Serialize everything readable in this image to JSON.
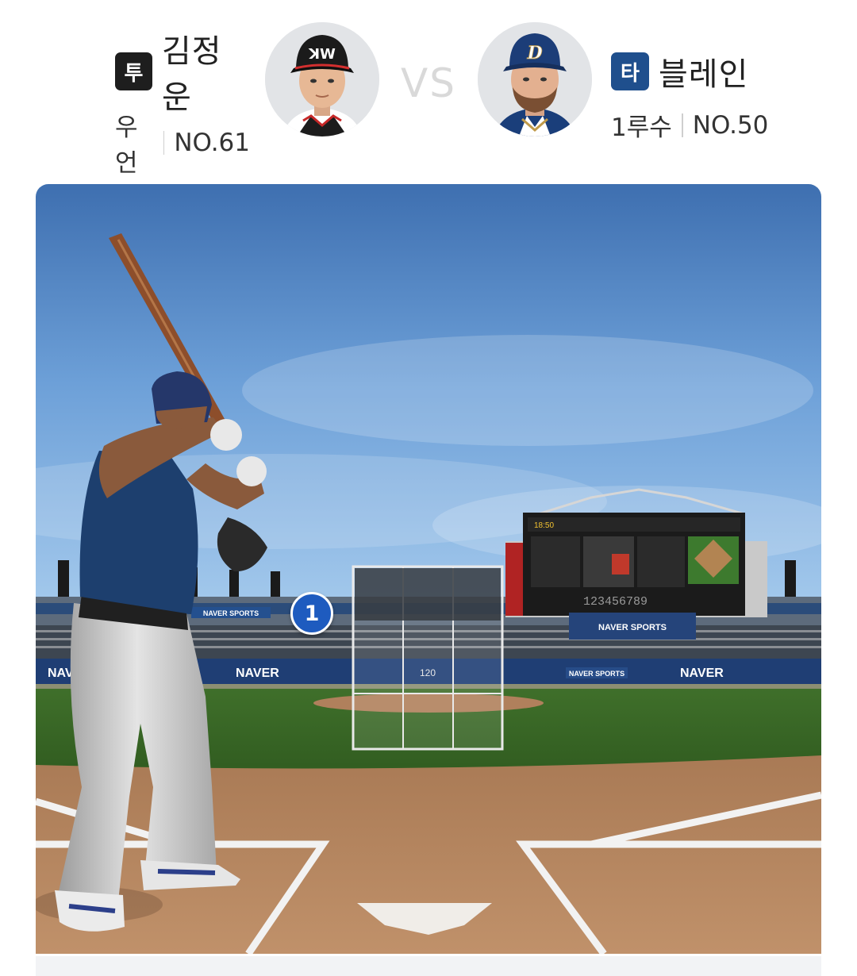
{
  "pitcher": {
    "role": "투",
    "name": "김정운",
    "hand": "우언",
    "number": "NO.61"
  },
  "versus": "VS",
  "batter": {
    "role": "타",
    "name": "블레인",
    "position": "1루수",
    "number": "NO.50"
  },
  "field": {
    "pitch_marker": "1",
    "speed_board": "120",
    "scoreboard_time": "18:50",
    "scoreboard_digits": "123456789",
    "ad_naver": "NAVER",
    "ad_naver_sports": "NAVER SPORTS"
  },
  "colors": {
    "pitcher_badge": "#1e1e1e",
    "batter_badge": "#1f4f8d",
    "marker": "#1e5bbf"
  }
}
